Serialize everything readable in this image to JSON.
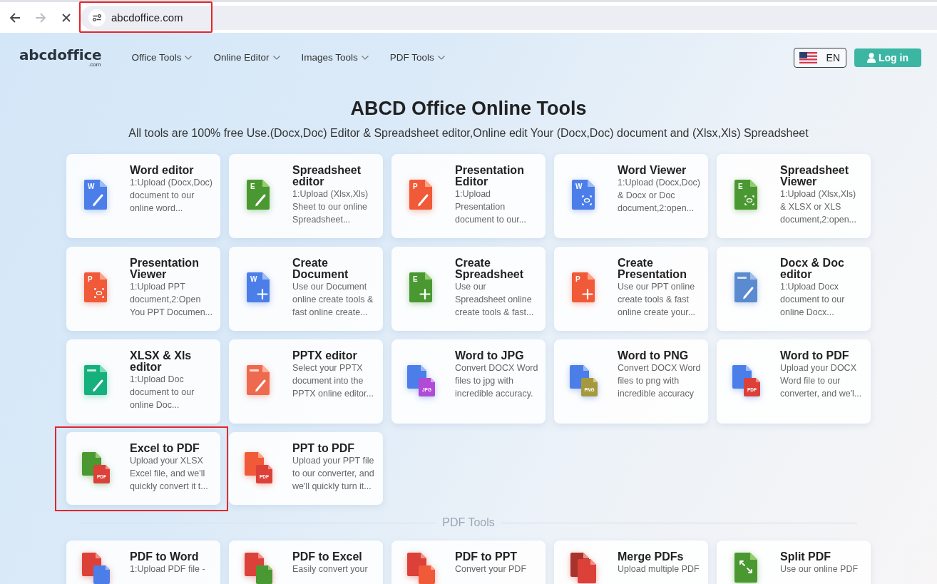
{
  "browser": {
    "nav_buttons": [
      {
        "kind": "back",
        "disabled": false
      },
      {
        "kind": "forward",
        "disabled": true
      },
      {
        "kind": "stop",
        "disabled": false
      }
    ],
    "url": "abcdoffice.com",
    "url_highlighted": true
  },
  "header": {
    "logo": {
      "name": "abcdoffice",
      "domain": ".com"
    },
    "nav": [
      {
        "label": "Office Tools"
      },
      {
        "label": "Online Editor"
      },
      {
        "label": "Images Tools"
      },
      {
        "label": "PDF Tools"
      }
    ],
    "language": {
      "code": "EN"
    },
    "login": {
      "label": "Log in"
    }
  },
  "hero": {
    "title": "ABCD Office Online Tools",
    "subtitle": "All tools are 100% free Use.(Docx,Doc) Editor & Spreadsheet editor,Online edit Your (Docx,Doc) document and (Xlsx,Xls) Spreadsheet"
  },
  "tools": [
    {
      "title": "Word editor",
      "description": "1:Upload (Docx,Doc) document to our online word...",
      "icon": {
        "kind": "word-edit",
        "letter": "W"
      },
      "highlighted": false
    },
    {
      "title": "Spreadsheet editor",
      "description": "1:Upload (Xlsx,Xls) Sheet to our online Spreadsheet...",
      "icon": {
        "kind": "sheet-edit",
        "letter": "E"
      },
      "highlighted": false
    },
    {
      "title": "Presentation Editor",
      "description": "1:Upload Presentation document to our...",
      "icon": {
        "kind": "ppt-edit",
        "letter": "P"
      },
      "highlighted": false
    },
    {
      "title": "Word Viewer",
      "description": "1:Upload (Docx,Doc) & Docx or Doc document,2:open...",
      "icon": {
        "kind": "word-view",
        "letter": "W"
      },
      "highlighted": false
    },
    {
      "title": "Spreadsheet Viewer",
      "description": "1:Upload (Xlsx,Xls) & XLSX or XLS document,2:open...",
      "icon": {
        "kind": "sheet-view",
        "letter": "E"
      },
      "highlighted": false
    },
    {
      "title": "Presentation Viewer",
      "description": "1:Upload PPT document,2:Open You PPT Documen...",
      "icon": {
        "kind": "ppt-view",
        "letter": "P"
      },
      "highlighted": false
    },
    {
      "title": "Create Document",
      "description": "Use our Document online create tools & fast online create...",
      "icon": {
        "kind": "word-create",
        "letter": "W"
      },
      "highlighted": false
    },
    {
      "title": "Create Spreadsheet",
      "description": "Use our Spreadsheet online create tools & fast...",
      "icon": {
        "kind": "sheet-create",
        "letter": "E"
      },
      "highlighted": false
    },
    {
      "title": "Create Presentation",
      "description": "Use our PPT online create tools & fast online create your...",
      "icon": {
        "kind": "ppt-create",
        "letter": "P"
      },
      "highlighted": false
    },
    {
      "title": "Docx & Doc editor",
      "description": "1:Upload Docx document to our online Docx...",
      "icon": {
        "kind": "docx-edit"
      },
      "highlighted": false
    },
    {
      "title": "XLSX & Xls editor",
      "description": "1:Upload Doc document to our online Doc...",
      "icon": {
        "kind": "xlsx-edit"
      },
      "highlighted": false
    },
    {
      "title": "PPTX editor",
      "description": "Select your PPTX document into the PPTX online editor...",
      "icon": {
        "kind": "pptx-edit"
      },
      "highlighted": false
    },
    {
      "title": "Word to JPG",
      "description": "Convert DOCX Word files to jpg with incredible accuracy.",
      "icon": {
        "kind": "word-to-jpg",
        "label": "JPG"
      },
      "highlighted": false
    },
    {
      "title": "Word to PNG",
      "description": "Convert DOCX Word files to png with incredible accuracy",
      "icon": {
        "kind": "word-to-png",
        "label": "PNG"
      },
      "highlighted": false
    },
    {
      "title": "Word to PDF",
      "description": "Upload your DOCX Word file to our converter, and we'l...",
      "icon": {
        "kind": "word-to-pdf",
        "label": "PDF"
      },
      "highlighted": false
    },
    {
      "title": "Excel to PDF",
      "description": "Upload your XLSX Excel file, and we'll quickly convert it t...",
      "icon": {
        "kind": "sheet-to-pdf",
        "label": "PDF"
      },
      "highlighted": true
    },
    {
      "title": "PPT to PDF",
      "description": "Upload your PPT file to our converter, and we'll quickly turn it...",
      "icon": {
        "kind": "ppt-to-pdf",
        "label": "PDF"
      },
      "highlighted": false
    }
  ],
  "pdf_tools": {
    "title": "PDF Tools",
    "tools": [
      {
        "title": "PDF to Word",
        "description": "1:Upload PDF file -",
        "icon": {
          "kind": "pdf-to-word"
        },
        "highlighted": false
      },
      {
        "title": "PDF to Excel",
        "description": "Easily convert your",
        "icon": {
          "kind": "pdf-to-sheet"
        },
        "highlighted": false
      },
      {
        "title": "PDF to PPT",
        "description": "Convert your PDF",
        "icon": {
          "kind": "pdf-to-ppt"
        },
        "highlighted": false
      },
      {
        "title": "Merge PDFs",
        "description": "Upload multiple PDF",
        "icon": {
          "kind": "pdf-merge"
        },
        "highlighted": false
      },
      {
        "title": "Split PDF",
        "description": "Use our online PDF",
        "icon": {
          "kind": "pdf-split"
        },
        "highlighted": false
      }
    ]
  }
}
